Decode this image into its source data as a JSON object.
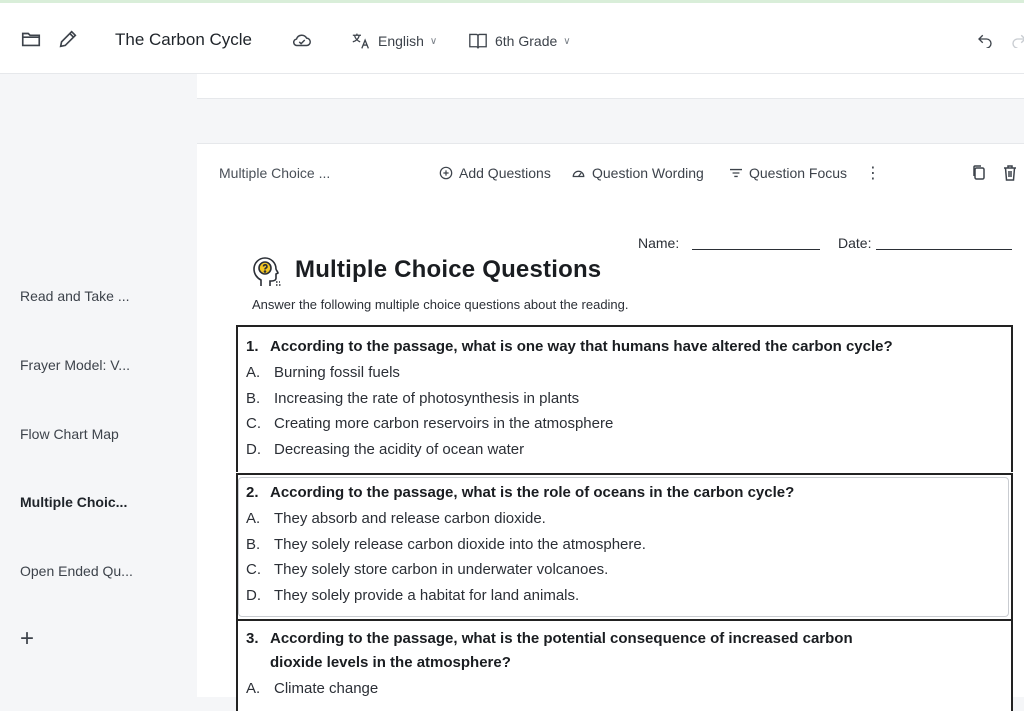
{
  "header": {
    "title": "The Carbon Cycle",
    "language": "English",
    "grade": "6th Grade",
    "icons": [
      "folder-icon",
      "edit-icon",
      "cloud-icon",
      "translate-icon",
      "book-icon",
      "undo-icon",
      "redo-icon"
    ]
  },
  "sidebar": {
    "items": [
      {
        "label": "Read and Take ..."
      },
      {
        "label": "Frayer Model: V..."
      },
      {
        "label": "Flow Chart Map"
      },
      {
        "label": "Multiple Choic..."
      },
      {
        "label": "Open Ended Qu..."
      }
    ],
    "add_label": "+"
  },
  "toolbar": {
    "section_label": "Multiple Choice ...",
    "add_questions": "Add Questions",
    "question_wording": "Question Wording",
    "question_focus": "Question Focus",
    "more": "⋮"
  },
  "worksheet": {
    "name_label": "Name:",
    "date_label": "Date:",
    "title": "Multiple Choice Questions",
    "instructions": "Answer the following multiple choice questions about the reading.",
    "questions": [
      {
        "number": "1.",
        "text": "According to the passage, what is one way that humans have altered the carbon cycle?",
        "options": [
          {
            "letter": "A.",
            "text": "Burning fossil fuels"
          },
          {
            "letter": "B.",
            "text": "Increasing the rate of photosynthesis in plants"
          },
          {
            "letter": "C.",
            "text": "Creating more carbon reservoirs in the atmosphere"
          },
          {
            "letter": "D.",
            "text": "Decreasing the acidity of ocean water"
          }
        ]
      },
      {
        "number": "2.",
        "text": "According to the passage, what is the role of oceans in the carbon cycle?",
        "options": [
          {
            "letter": "A.",
            "text": "They absorb and release carbon dioxide."
          },
          {
            "letter": "B.",
            "text": "They solely release carbon dioxide into the atmosphere."
          },
          {
            "letter": "C.",
            "text": "They solely store carbon in underwater volcanoes."
          },
          {
            "letter": "D.",
            "text": "They solely provide a habitat for land animals."
          }
        ]
      },
      {
        "number": "3.",
        "text_line1": "According to the passage, what is the potential consequence of increased carbon",
        "text_line2": "dioxide levels in the atmosphere?",
        "options": [
          {
            "letter": "A.",
            "text": "Climate change"
          }
        ]
      }
    ]
  }
}
